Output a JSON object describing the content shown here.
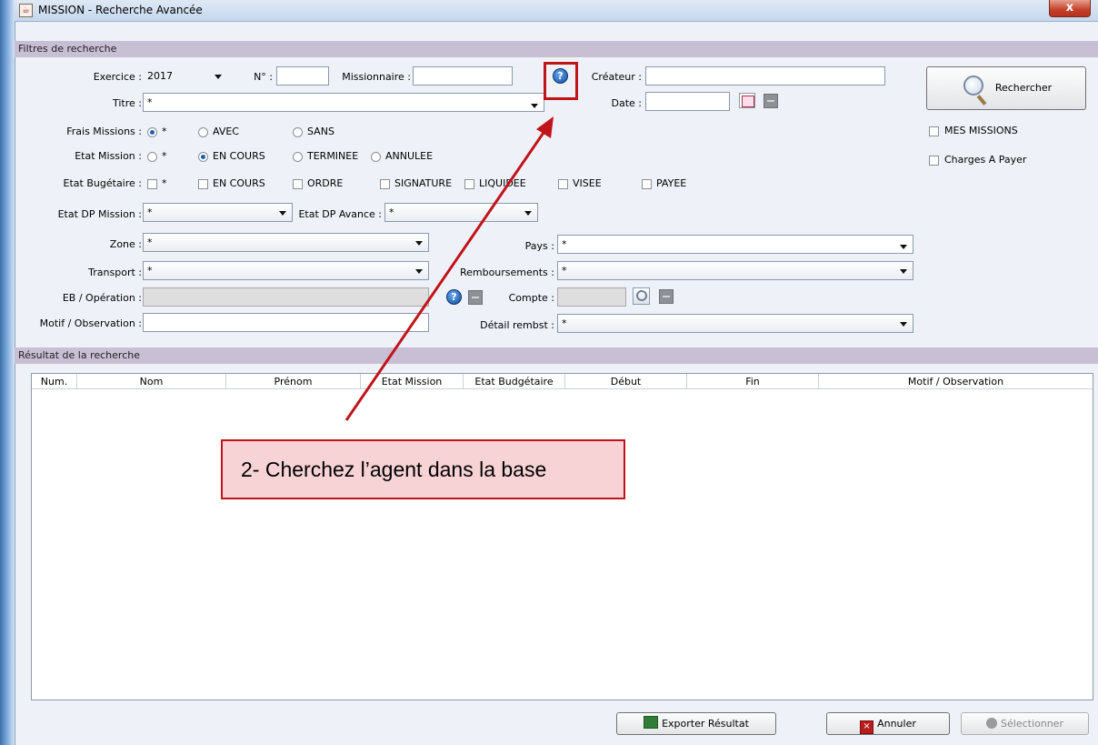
{
  "window": {
    "title": "MISSION - Recherche Avancée",
    "close_glyph": "x"
  },
  "filters": {
    "header": "Filtres de recherche",
    "exercice": {
      "label": "Exercice :",
      "value": "2017"
    },
    "numero": {
      "label": "N° :",
      "value": ""
    },
    "missionnaire": {
      "label": "Missionnaire :",
      "value": ""
    },
    "createur": {
      "label": "Créateur :",
      "value": ""
    },
    "titre": {
      "label": "Titre :",
      "value": "*"
    },
    "date": {
      "label": "Date :",
      "value": ""
    },
    "frais_missions": {
      "label": "Frais Missions :",
      "options": [
        "*",
        "AVEC",
        "SANS"
      ],
      "selected": "*"
    },
    "etat_mission": {
      "label": "Etat Mission :",
      "options": [
        "*",
        "EN COURS",
        "TERMINEE",
        "ANNULEE"
      ],
      "selected": "EN COURS"
    },
    "etat_budgetaire": {
      "label": "Etat Bugétaire :",
      "options": [
        "*",
        "EN COURS",
        "ORDRE",
        "SIGNATURE",
        "LIQUIDEE",
        "VISEE",
        "PAYEE"
      ]
    },
    "etat_dp_mission": {
      "label": "Etat DP Mission :",
      "value": "*"
    },
    "etat_dp_avance": {
      "label": "Etat DP Avance :",
      "value": "*"
    },
    "zone": {
      "label": "Zone :",
      "value": "*"
    },
    "pays": {
      "label": "Pays :",
      "value": "*"
    },
    "transport": {
      "label": "Transport :",
      "value": "*"
    },
    "remboursements": {
      "label": "Remboursements :",
      "value": "*"
    },
    "eb_operation": {
      "label": "EB / Opération :",
      "value": ""
    },
    "compte": {
      "label": "Compte :",
      "value": ""
    },
    "motif": {
      "label": "Motif / Observation :",
      "value": ""
    },
    "detail_rembst": {
      "label": "Détail rembst :",
      "value": "*"
    }
  },
  "side": {
    "search_button": "Rechercher",
    "mes_missions": "MES MISSIONS",
    "charges_a_payer": "Charges A Payer"
  },
  "results": {
    "header": "Résultat de la recherche",
    "columns": [
      "Num.",
      "Nom",
      "Prénom",
      "Etat Mission",
      "Etat Budgétaire",
      "Début",
      "Fin",
      "Motif / Observation"
    ],
    "rows": []
  },
  "footer": {
    "export_button": "Exporter Résultat",
    "cancel_button": "Annuler",
    "select_button": "Sélectionner"
  },
  "annotation": {
    "callout": "2-   Cherchez l’agent dans la base"
  },
  "colors": {
    "accent": "#c0131a",
    "section_header": "#c8bfd4",
    "callout_fill": "#f7d3d5"
  }
}
